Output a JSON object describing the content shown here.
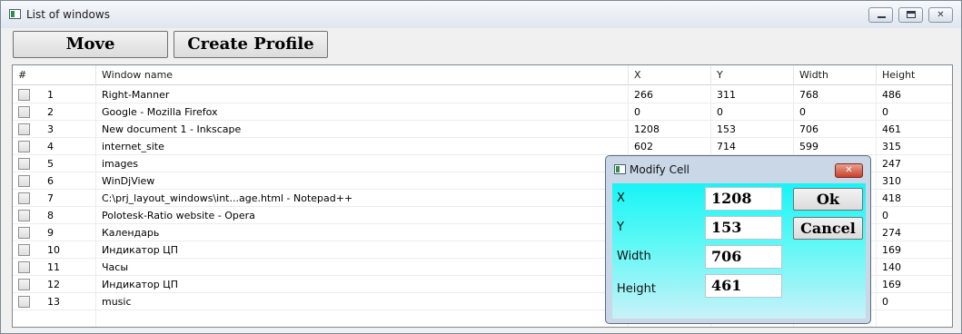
{
  "window": {
    "title": "List of windows"
  },
  "toolbar": {
    "move_label": "Move",
    "create_profile_label": "Create Profile"
  },
  "list": {
    "headers": [
      "#",
      "Window name",
      "X",
      "Y",
      "Width",
      "Height"
    ],
    "rows": [
      {
        "num": "1",
        "name": "Right-Manner",
        "x": "266",
        "y": "311",
        "width": "768",
        "height": "486"
      },
      {
        "num": "2",
        "name": "Google - Mozilla Firefox",
        "x": "0",
        "y": "0",
        "width": "0",
        "height": "0"
      },
      {
        "num": "3",
        "name": "New document 1 - Inkscape",
        "x": "1208",
        "y": "153",
        "width": "706",
        "height": "461"
      },
      {
        "num": "4",
        "name": "internet_site",
        "x": "602",
        "y": "714",
        "width": "599",
        "height": "315"
      },
      {
        "num": "5",
        "name": "images",
        "x": "",
        "y": "",
        "width": "",
        "height": "247"
      },
      {
        "num": "6",
        "name": "WinDjView",
        "x": "",
        "y": "",
        "width": "",
        "height": "310"
      },
      {
        "num": "7",
        "name": "C:\\prj_layout_windows\\int...age.html - Notepad++",
        "x": "",
        "y": "",
        "width": "",
        "height": "418"
      },
      {
        "num": "8",
        "name": "Polotesk-Ratio website - Opera",
        "x": "",
        "y": "",
        "width": "",
        "height": "0"
      },
      {
        "num": "9",
        "name": "Календарь",
        "x": "",
        "y": "",
        "width": "",
        "height": "274"
      },
      {
        "num": "10",
        "name": "Индикатор ЦП",
        "x": "",
        "y": "",
        "width": "",
        "height": "169"
      },
      {
        "num": "11",
        "name": "Часы",
        "x": "",
        "y": "",
        "width": "",
        "height": "140"
      },
      {
        "num": "12",
        "name": "Индикатор ЦП",
        "x": "",
        "y": "",
        "width": "",
        "height": "169"
      },
      {
        "num": "13",
        "name": "music",
        "x": "",
        "y": "",
        "width": "",
        "height": "0"
      }
    ]
  },
  "dialog": {
    "title": "Modify Cell",
    "fields": [
      {
        "label": "X",
        "value": "1208"
      },
      {
        "label": "Y",
        "value": "153"
      },
      {
        "label": "Width",
        "value": "706"
      },
      {
        "label": "Height",
        "value": "461"
      }
    ],
    "ok_label": "Ok",
    "cancel_label": "Cancel"
  },
  "colors": {
    "dialog_body_top": "#18f4f6",
    "dialog_body_bottom": "#c8f2f8",
    "close_button": "#c8412b"
  }
}
